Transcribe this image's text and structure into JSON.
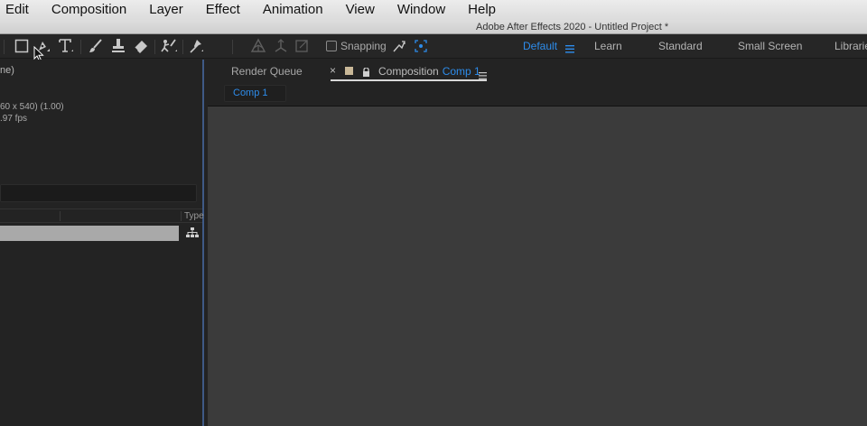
{
  "menubar": {
    "items": [
      "Edit",
      "Composition",
      "Layer",
      "Effect",
      "Animation",
      "View",
      "Window",
      "Help"
    ]
  },
  "titlebar": {
    "title": "Adobe After Effects 2020 - Untitled Project *"
  },
  "toolbar": {
    "tools": [
      "rectangle-tool",
      "pen-tool",
      "type-tool",
      "brush-tool",
      "clone-stamp-tool",
      "eraser-tool",
      "roto-brush-tool",
      "puppet-pin-tool"
    ],
    "snapping_label": "Snapping",
    "workspaces": [
      {
        "label": "Default",
        "active": true
      },
      {
        "label": "Learn",
        "active": false
      },
      {
        "label": "Standard",
        "active": false
      },
      {
        "label": "Small Screen",
        "active": false
      },
      {
        "label": "Librarie",
        "active": false
      }
    ]
  },
  "project_panel": {
    "header_fragment": "ne)",
    "info_line_1": "60 x 540) (1.00)",
    "info_line_2": ".97 fps",
    "column_type": "Type"
  },
  "composition_panel": {
    "render_queue_tab": "Render Queue",
    "close_glyph": "×",
    "comp_tab_label": "Composition",
    "comp_tab_name": "Comp 1",
    "breadcrumb": "Comp 1"
  },
  "colors": {
    "accent": "#2d8ceb",
    "panel_bg": "#232323",
    "viewer_bg": "#3b3b3b",
    "selection_row": "#a9a9a9",
    "panel_border_active": "#3f5a86"
  }
}
